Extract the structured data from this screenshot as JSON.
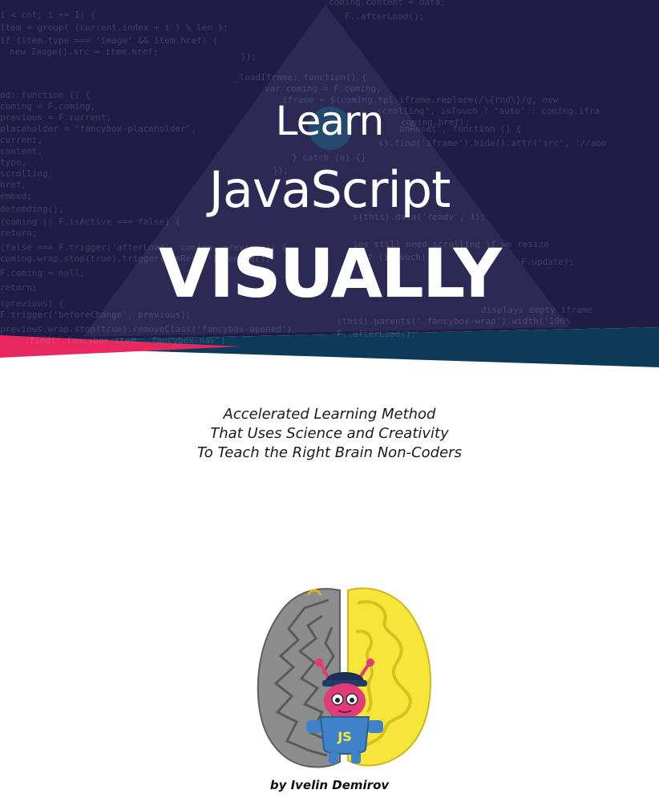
{
  "cover": {
    "title_line1": "Learn",
    "title_line2": "JavaScript",
    "title_line3": "VISUALLY",
    "subtitle_lines": [
      "Accelerated Learning Method",
      "That Uses Science and Creativity",
      "To Teach the Right Brain Non-Coders"
    ],
    "author": "by Ivelin Demirov",
    "badge_text": "JS"
  },
  "code_background": [
    "coming.content = data;",
    "F..afterLoad();",
    "i < cnt; i += 1) {",
    "item = group( (current.index + i ) % len );",
    "if (item.type === 'image' && item.href) {",
    "new Image().src = item.href;",
    "});",
    "_loadIframe: function() {",
    "var coming = F.coming,",
    "iframe = $(coming.tpl.iframe.replace(/\\{rnd\\}/g, new",
    "scrolling', isTouch ? 'auto' : coming.ifra",
    "coming.href);",
    "od: function () {",
    "coming = F.coming,",
    "previous = F.current,",
    "placeholder = 'fancybox-placeholder',",
    "current,",
    "content,",
    "type,",
    "scrolling,",
    "href,",
    "embed;",
    "onReset', function () {",
    "s).find('iframe').hide().attr('src', '//abo",
    "} catch (e) {}",
    "});",
    "detemding();",
    "(coming || F.isActive === false) {",
    "return;",
    "s(this).data('ready', 1);",
    "(false === F.trigger('afterLoad', coming, previous)) {",
    "coming.wrap.stop(true).trigger('onReset').remove();",
    "F.coming = null;",
    "ios still need scrolling if we resize",
    "if (isTouch) {",
    "F.update);",
    "return;",
    "(previous) {",
    "F.trigger('beforeChange', previous);",
    "displays empty iframe",
    "(this).parents('.fancybox-wrap').width('100%",
    "previous.wrap.stop(true).removeClass('fancybox-opened')",
    ".find('.fancybox-item, .fancybox-nav')",
    "F..afterLoad();"
  ],
  "colors": {
    "navy": "#1f1d45",
    "triangle": "#2c2a55",
    "teal": "#0e3a59",
    "pink": "#e8275e",
    "brain_gray": "#8d8d8d",
    "brain_yellow": "#f7e63a",
    "robot_pink": "#e33a7a",
    "robot_blue": "#3f82c7"
  }
}
